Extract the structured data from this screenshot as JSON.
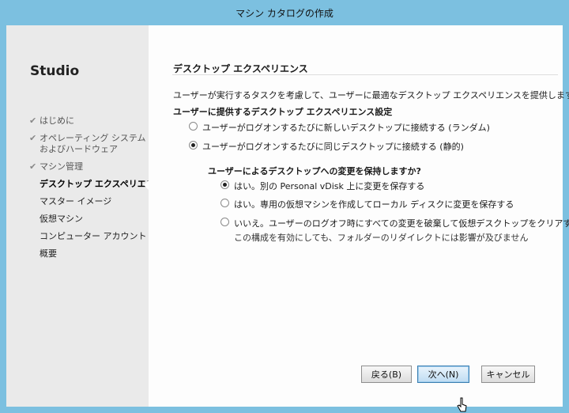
{
  "window": {
    "title": "マシン カタログの作成"
  },
  "sidebar": {
    "brand": "Studio",
    "items": [
      {
        "label": "はじめに",
        "state": "done"
      },
      {
        "label": "オペレーティング システム",
        "label2": "およびハードウェア",
        "state": "done"
      },
      {
        "label": "マシン管理",
        "state": "done"
      },
      {
        "label": "デスクトップ エクスペリエンス",
        "state": "current"
      },
      {
        "label": "マスター イメージ",
        "state": "pending"
      },
      {
        "label": "仮想マシン",
        "state": "pending"
      },
      {
        "label": "コンピューター アカウント",
        "state": "pending"
      },
      {
        "label": "概要",
        "state": "pending"
      }
    ]
  },
  "main": {
    "title": "デスクトップ エクスペリエンス",
    "description": "ユーザーが実行するタスクを考慮して、ユーザーに最適なデスクトップ エクスペリエンスを提供します。",
    "section_label": "ユーザーに提供するデスクトップ エクスペリエンス設定",
    "experience_options": [
      {
        "label": "ユーザーがログオンするたびに新しいデスクトップに接続する (ランダム)",
        "selected": false
      },
      {
        "label": "ユーザーがログオンするたびに同じデスクトップに接続する (静的)",
        "selected": true
      }
    ],
    "persist_question": "ユーザーによるデスクトップへの変更を保持しますか?",
    "persist_options": [
      {
        "label": "はい。別の Personal vDisk 上に変更を保存する",
        "selected": true
      },
      {
        "label": "はい。専用の仮想マシンを作成してローカル ディスクに変更を保存する",
        "selected": false
      },
      {
        "label": "いいえ。ユーザーのログオフ時にすべての変更を破棄して仮想デスクトップをクリアする",
        "note": "この構成を有効にしても、フォルダーのリダイレクトには影響が及びません",
        "selected": false
      }
    ]
  },
  "buttons": {
    "back": "戻る(B)",
    "next": "次へ(N)",
    "cancel": "キャンセル"
  },
  "colors": {
    "titlebar": "#7cc0e0",
    "sidebar": "#eaeaea",
    "primary_border": "#3c7fb1"
  }
}
